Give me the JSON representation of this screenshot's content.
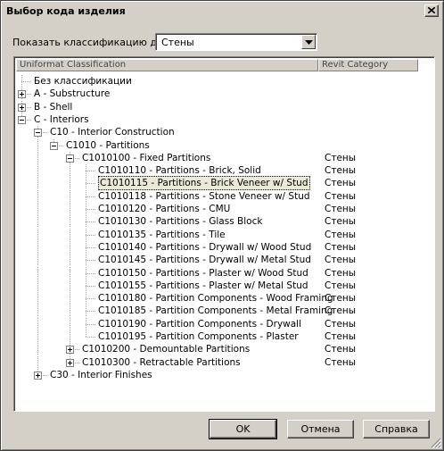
{
  "dialog": {
    "title": "Выбор кода изделия"
  },
  "filter": {
    "label": "Показать классификацию для:",
    "value": "Стены"
  },
  "tree": {
    "columns": [
      "Uniformat Classification",
      "Revit Category"
    ],
    "nodes": [
      {
        "text": "Без классификации",
        "category": "",
        "level": 0,
        "expander": "none"
      },
      {
        "text": "A - Substructure",
        "category": "",
        "level": 0,
        "expander": "plus"
      },
      {
        "text": "B - Shell",
        "category": "",
        "level": 0,
        "expander": "plus"
      },
      {
        "text": "C - Interiors",
        "category": "",
        "level": 0,
        "expander": "minus"
      },
      {
        "text": "C10 - Interior Construction",
        "category": "",
        "level": 1,
        "expander": "minus"
      },
      {
        "text": "C1010 - Partitions",
        "category": "",
        "level": 2,
        "expander": "minus"
      },
      {
        "text": "C1010100 - Fixed Partitions",
        "category": "Стены",
        "level": 3,
        "expander": "minus"
      },
      {
        "text": "C1010110 - Partitions - Brick, Solid",
        "category": "Стены",
        "level": 4,
        "expander": "none"
      },
      {
        "text": "C1010115 - Partitions - Brick Veneer w/ Stud",
        "category": "Стены",
        "level": 4,
        "expander": "none",
        "selected": true
      },
      {
        "text": "C1010118 - Partitions - Stone Veneer w/ Stud",
        "category": "Стены",
        "level": 4,
        "expander": "none"
      },
      {
        "text": "C1010120 - Partitions - CMU",
        "category": "Стены",
        "level": 4,
        "expander": "none"
      },
      {
        "text": "C1010130 - Partitions - Glass Block",
        "category": "Стены",
        "level": 4,
        "expander": "none"
      },
      {
        "text": "C1010135 - Partitions - Tile",
        "category": "Стены",
        "level": 4,
        "expander": "none"
      },
      {
        "text": "C1010140 - Partitions - Drywall w/ Wood Stud",
        "category": "Стены",
        "level": 4,
        "expander": "none"
      },
      {
        "text": "C1010145 - Partitions - Drywall w/ Metal Stud",
        "category": "Стены",
        "level": 4,
        "expander": "none"
      },
      {
        "text": "C1010150 - Partitions - Plaster w/ Wood Stud",
        "category": "Стены",
        "level": 4,
        "expander": "none"
      },
      {
        "text": "C1010155 - Partitions - Plaster w/ Metal Stud",
        "category": "Стены",
        "level": 4,
        "expander": "none"
      },
      {
        "text": "C1010180 - Partition Components - Wood Framing",
        "category": "Стены",
        "level": 4,
        "expander": "none"
      },
      {
        "text": "C1010185 - Partition Components - Metal Framing",
        "category": "Стены",
        "level": 4,
        "expander": "none"
      },
      {
        "text": "C1010190 - Partition Components - Drywall",
        "category": "Стены",
        "level": 4,
        "expander": "none"
      },
      {
        "text": "C1010195 - Partition Components - Plaster",
        "category": "Стены",
        "level": 4,
        "expander": "none"
      },
      {
        "text": "C1010200 - Demountable Partitions",
        "category": "Стены",
        "level": 3,
        "expander": "plus"
      },
      {
        "text": "C1010300 - Retractable Partitions",
        "category": "Стены",
        "level": 3,
        "expander": "plus"
      },
      {
        "text": "C30 - Interior Finishes",
        "category": "",
        "level": 1,
        "expander": "plus"
      }
    ]
  },
  "buttons": {
    "ok": "OK",
    "cancel": "Отмена",
    "help": "Справка"
  },
  "icons": {
    "close": "close-icon",
    "dropdown": "chevron-down-icon"
  }
}
